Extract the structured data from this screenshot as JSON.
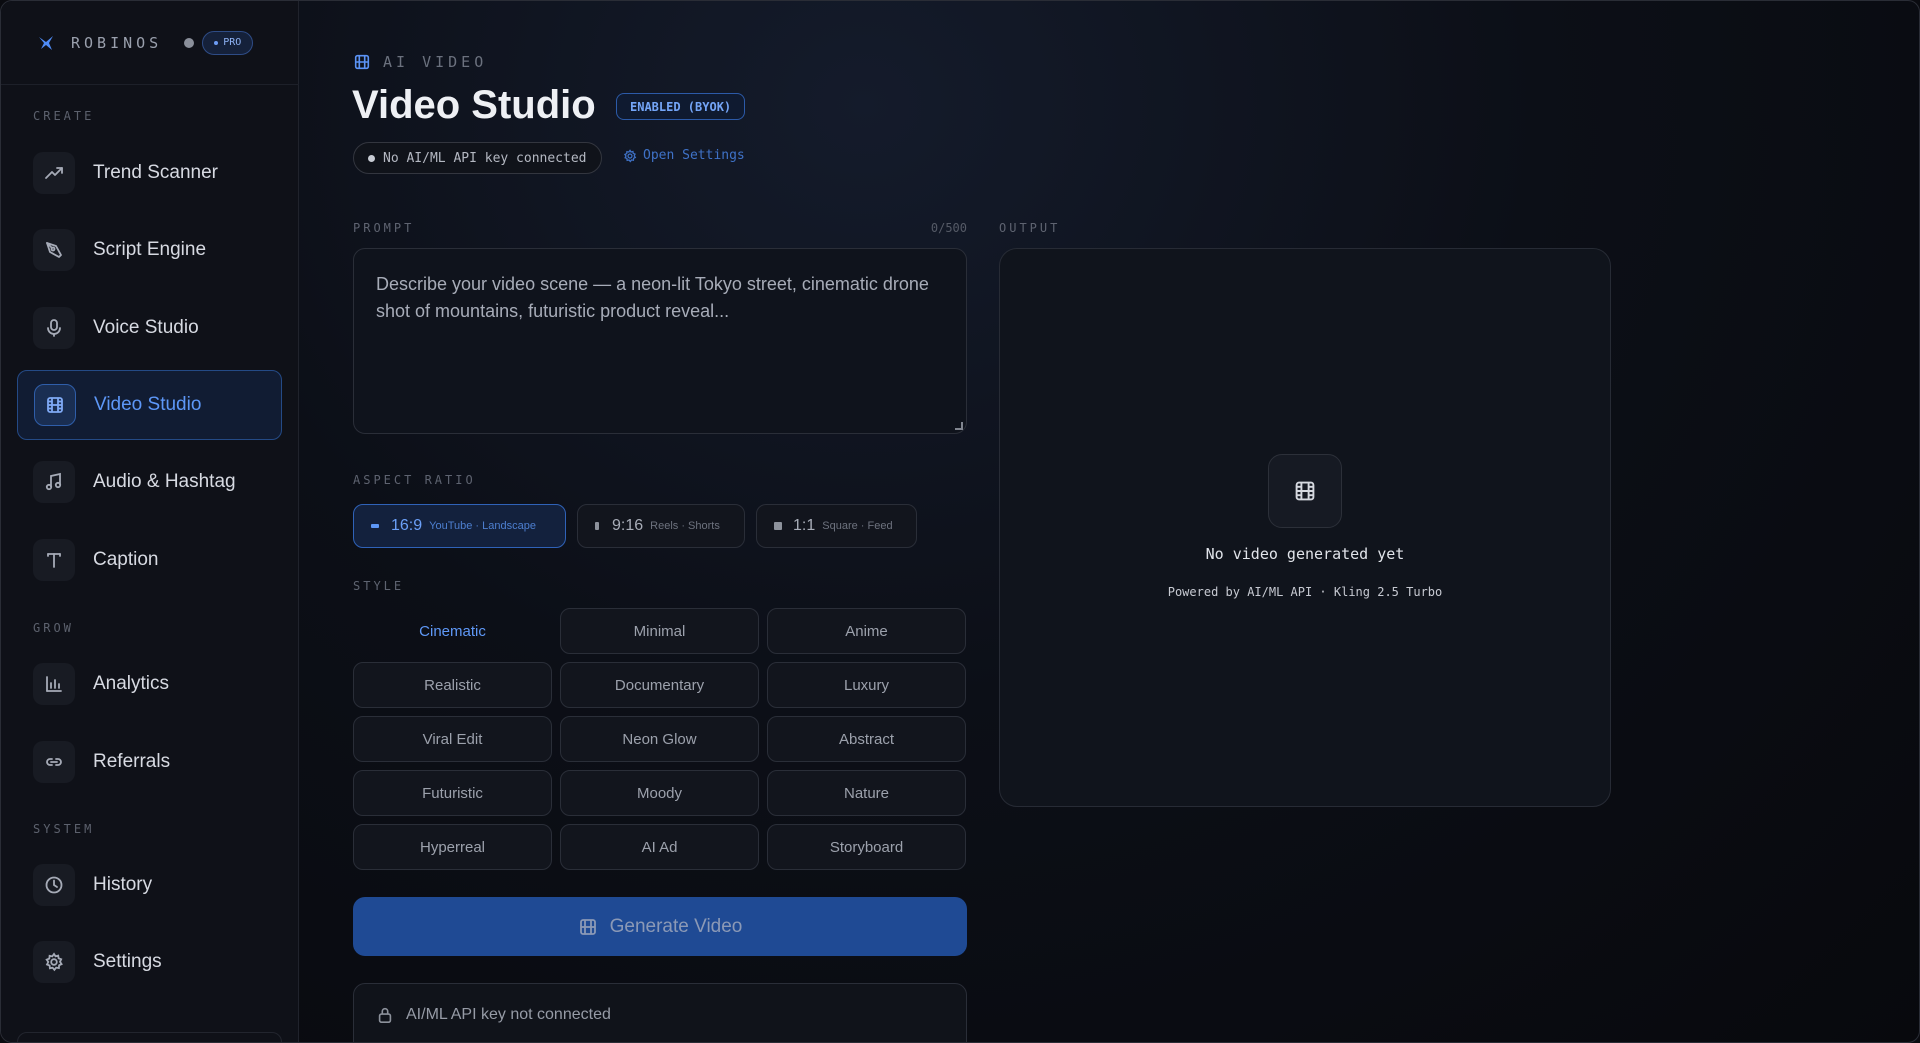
{
  "brand": {
    "name": "ROBINOS",
    "plan_badge": "PRO",
    "accent": "#4f8cf7"
  },
  "sidebar": {
    "sections": [
      {
        "label": "CREATE"
      },
      {
        "label": "GROW"
      },
      {
        "label": "SYSTEM"
      }
    ],
    "items": [
      {
        "label": "Trend Scanner",
        "icon": "trend-icon"
      },
      {
        "label": "Script Engine",
        "icon": "pen-icon"
      },
      {
        "label": "Voice Studio",
        "icon": "mic-icon"
      },
      {
        "label": "Video Studio",
        "icon": "film-icon",
        "active": true
      },
      {
        "label": "Audio & Hashtag",
        "icon": "music-icon"
      },
      {
        "label": "Caption",
        "icon": "text-icon"
      },
      {
        "label": "Analytics",
        "icon": "bar-chart-icon"
      },
      {
        "label": "Referrals",
        "icon": "link-icon"
      },
      {
        "label": "History",
        "icon": "clock-icon"
      },
      {
        "label": "Settings",
        "icon": "gear-icon"
      }
    ]
  },
  "header": {
    "eyebrow": "AI VIDEO",
    "title": "Video Studio",
    "status_badge": "ENABLED (BYOK)",
    "api_status": "No AI/ML API key connected",
    "settings_link": "Open Settings"
  },
  "prompt": {
    "label": "PROMPT",
    "char_count": "0/500",
    "placeholder": "Describe your video scene — a neon-lit Tokyo street, cinematic drone shot of mountains, futuristic product reveal...",
    "value": ""
  },
  "aspect_ratio": {
    "label": "ASPECT RATIO",
    "options": [
      {
        "ratio": "16:9",
        "desc": "YouTube · Landscape",
        "selected": true
      },
      {
        "ratio": "9:16",
        "desc": "Reels · Shorts",
        "selected": false
      },
      {
        "ratio": "1:1",
        "desc": "Square · Feed",
        "selected": false
      }
    ]
  },
  "style": {
    "label": "STYLE",
    "selected": "Cinematic",
    "options": [
      "Cinematic",
      "Minimal",
      "Anime",
      "Realistic",
      "Documentary",
      "Luxury",
      "Viral Edit",
      "Neon Glow",
      "Abstract",
      "Futuristic",
      "Moody",
      "Nature",
      "Hyperreal",
      "AI Ad",
      "Storyboard"
    ]
  },
  "generate": {
    "label": "Generate Video"
  },
  "notice": {
    "text": "AI/ML API key not connected"
  },
  "output": {
    "label": "OUTPUT",
    "empty_title": "No video generated yet",
    "powered_by": "Powered by AI/ML API · Kling 2.5 Turbo"
  }
}
